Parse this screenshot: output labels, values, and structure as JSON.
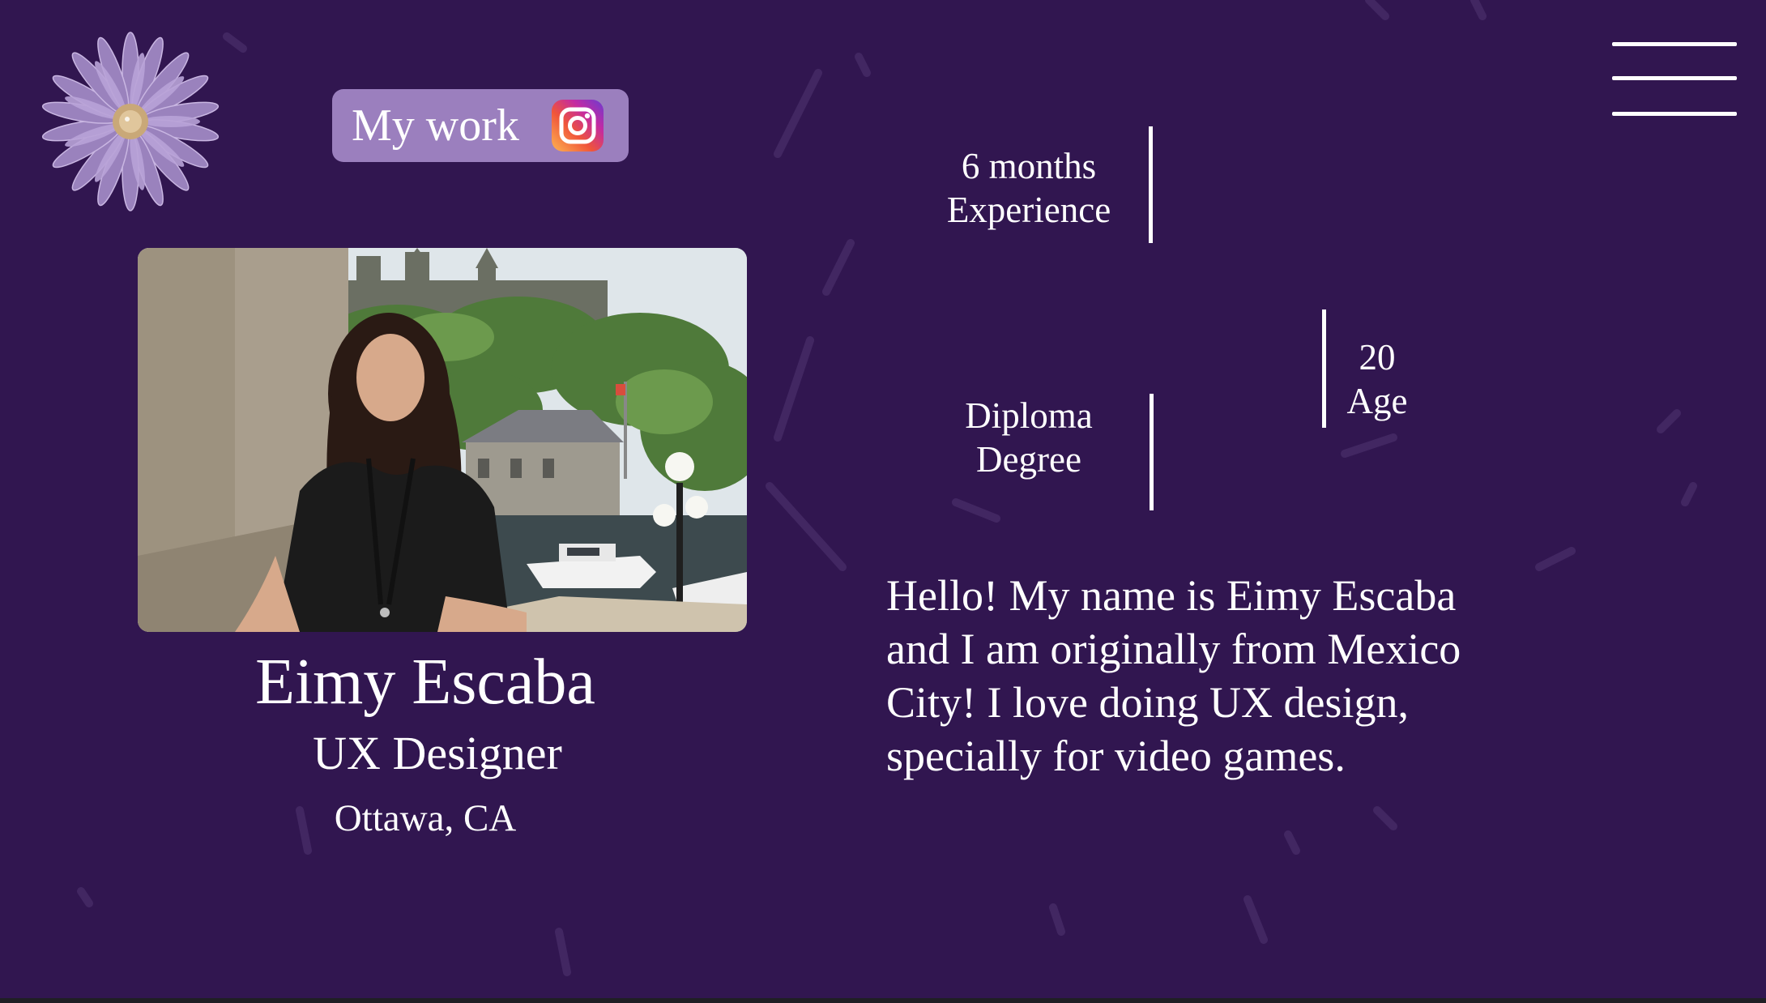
{
  "header": {
    "my_work_label": "My work",
    "instagram_icon": "instagram-icon",
    "menu_icon": "hamburger-menu-icon",
    "logo_icon": "purple-flower-logo"
  },
  "stats": {
    "experience": {
      "value": "6 months",
      "label": "Experience"
    },
    "age": {
      "value": "20",
      "label": "Age"
    },
    "education": {
      "value": "Diploma",
      "label": "Degree"
    }
  },
  "profile": {
    "name": "Eimy Escaba",
    "role": "UX Designer",
    "location": "Ottawa, CA",
    "photo_icon": "profile-photo"
  },
  "bio": {
    "line1": "Hello! My name is Eimy Escaba",
    "line2": "and I am originally from Mexico",
    "line3": "City! I love doing UX design,",
    "line4": "specially for video games."
  },
  "colors": {
    "background": "#311650",
    "button": "#9b7fbe",
    "text": "#ffffff"
  }
}
